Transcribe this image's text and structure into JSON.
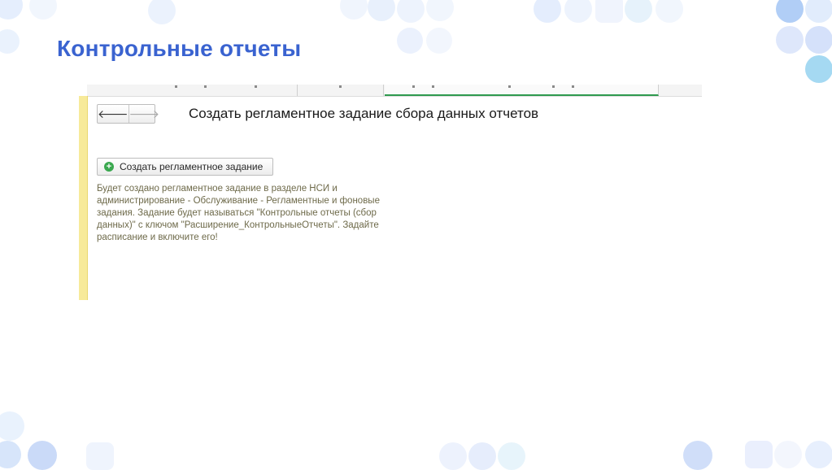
{
  "slide": {
    "title": "Контрольные отчеты"
  },
  "form": {
    "title": "Создать регламентное задание сбора данных отчетов",
    "nav": {
      "back_icon": "arrow-left-icon",
      "forward_icon": "arrow-right-icon",
      "back_glyph": "🡐",
      "forward_glyph": "🡒"
    },
    "action_button": {
      "label": "Создать регламентное задание",
      "icon": "plus-circle-icon"
    },
    "info": "Будет создано регламентное задание в разделе НСИ и администрирование - Обслуживание - Регламентные и фоновые задания. Задание будет называться \"Контрольные отчеты (сбор данных)\" с ключом \"Расширение_КонтрольныеОтчеты\". Задайте расписание и включите его!"
  },
  "colors": {
    "title": "#3a63d0",
    "active_tab_underline": "#2f9a4e",
    "side_strip": "#f7ea9a",
    "plus_icon": "#3aa84f",
    "info_text": "#6e6a4a"
  }
}
